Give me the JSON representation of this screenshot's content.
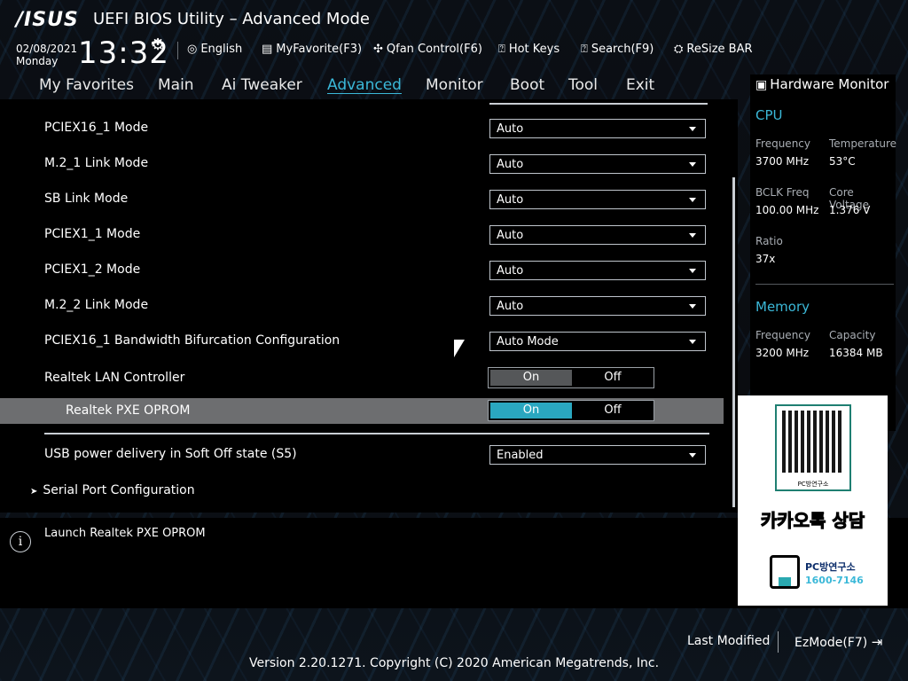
{
  "header": {
    "logo": "/ISUS",
    "title": "UEFI BIOS Utility – Advanced Mode",
    "date": "02/08/2021",
    "day": "Monday",
    "time": "13:32",
    "toolbar": [
      {
        "icon": "globe-icon",
        "label": "English"
      },
      {
        "icon": "favorite-icon",
        "label": "MyFavorite(F3)"
      },
      {
        "icon": "fan-icon",
        "label": "Qfan Control(F6)"
      },
      {
        "icon": "hotkeys-icon",
        "label": "Hot Keys"
      },
      {
        "icon": "search-icon",
        "label": "Search(F9)"
      },
      {
        "icon": "resize-bar-icon",
        "label": "ReSize BAR"
      }
    ]
  },
  "nav": {
    "tabs": [
      "My Favorites",
      "Main",
      "Ai Tweaker",
      "Advanced",
      "Monitor",
      "Boot",
      "Tool",
      "Exit"
    ],
    "active": "Advanced"
  },
  "settings": [
    {
      "label": "PCIEX16_1 Mode",
      "value": "Auto"
    },
    {
      "label": "M.2_1 Link Mode",
      "value": "Auto"
    },
    {
      "label": "SB Link Mode",
      "value": "Auto"
    },
    {
      "label": "PCIEX1_1 Mode",
      "value": "Auto"
    },
    {
      "label": "PCIEX1_2 Mode",
      "value": "Auto"
    },
    {
      "label": "M.2_2 Link Mode",
      "value": "Auto"
    },
    {
      "label": "PCIEX16_1 Bandwidth Bifurcation Configuration",
      "value": "Auto Mode"
    },
    {
      "label": "Realtek LAN Controller",
      "on": "On",
      "off": "Off"
    },
    {
      "label": "Realtek PXE OPROM",
      "on": "On",
      "off": "Off"
    },
    {
      "label": "USB power delivery in Soft Off state (S5)",
      "value": "Enabled"
    },
    {
      "label": "Serial Port Configuration"
    }
  ],
  "help": {
    "text": "Launch Realtek PXE OPROM"
  },
  "hardware_monitor": {
    "title": "Hardware Monitor",
    "cpu": {
      "title": "CPU",
      "frequency_label": "Frequency",
      "frequency": "3700 MHz",
      "temperature_label": "Temperature",
      "temperature": "53°C",
      "bclk_label": "BCLK Freq",
      "bclk": "100.00 MHz",
      "voltage_label": "Core Voltage",
      "voltage": "1.376 V",
      "ratio_label": "Ratio",
      "ratio": "37x"
    },
    "memory": {
      "title": "Memory",
      "frequency_label": "Frequency",
      "frequency": "3200 MHz",
      "capacity_label": "Capacity",
      "capacity": "16384 MB"
    }
  },
  "overlay": {
    "qr_caption": "PC방연구소",
    "kakao": "카카오톡 상담",
    "brand": "PC방연구소",
    "phone": "1600-7146"
  },
  "footer": {
    "last_modified": "Last Modified",
    "ezmode": "EzMode(F7)",
    "version": "Version 2.20.1271. Copyright (C) 2020 American Megatrends, Inc."
  },
  "colors": {
    "accent": "#3bb8d8",
    "toggle_on_active": "#2aa7c0",
    "toggle_on_inactive": "#555759",
    "highlight_row": "#6d6e70"
  }
}
